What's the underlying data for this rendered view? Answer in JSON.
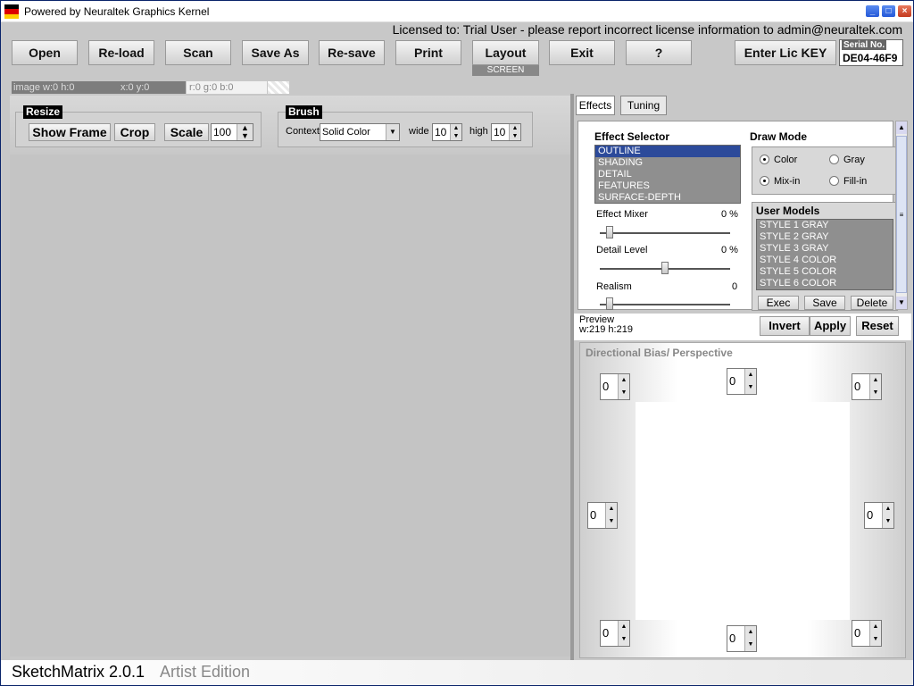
{
  "window": {
    "title": "Powered by Neuraltek Graphics Kernel",
    "minimize": "_",
    "maximize": "□",
    "close": "×",
    "flag_colors": [
      "#000000",
      "#dd0000",
      "#ffce00"
    ]
  },
  "license_text": "Licensed to: Trial User - please report incorrect license information to admin@neuraltek.com",
  "toolbar": {
    "open": "Open",
    "reload": "Re-load",
    "scan": "Scan",
    "save_as": "Save As",
    "resave": "Re-save",
    "print": "Print",
    "layout": "Layout",
    "layout_mode": "SCREEN",
    "exit": "Exit",
    "help": "?",
    "enter_key": "Enter Lic KEY",
    "serial_label": "Serial No.",
    "serial_value": "DE04-46F9"
  },
  "status": {
    "image_size": "image w:0 h:0",
    "xy": "x:0 y:0",
    "rgb": "r:0 g:0 b:0"
  },
  "resize": {
    "label": "Resize",
    "show_frame": "Show Frame",
    "crop": "Crop",
    "scale": "Scale",
    "scale_value": "100"
  },
  "brush": {
    "label": "Brush",
    "context_label": "Context",
    "context_value": "Solid Color",
    "wide_label": "wide",
    "wide_value": "10",
    "high_label": "high",
    "high_value": "10"
  },
  "tabs": {
    "effects": "Effects",
    "tuning": "Tuning"
  },
  "effect_selector": {
    "heading": "Effect Selector",
    "items": [
      "OUTLINE",
      "SHADING",
      "DETAIL",
      "FEATURES",
      "SURFACE-DEPTH"
    ],
    "selected_index": 0
  },
  "sliders": {
    "effect_mixer": {
      "label": "Effect Mixer",
      "value": "0 %",
      "level": 0.05
    },
    "detail_level": {
      "label": "Detail Level",
      "value": "0 %",
      "level": 0.5
    },
    "realism": {
      "label": "Realism",
      "value": "0",
      "level": 0.05
    }
  },
  "draw_mode": {
    "heading": "Draw Mode",
    "color": "Color",
    "gray": "Gray",
    "mixin": "Mix-in",
    "fillin": "Fill-in"
  },
  "user_models": {
    "heading": "User Models",
    "items": [
      "STYLE 1 GRAY",
      "STYLE 2 GRAY",
      "STYLE 3 GRAY",
      "STYLE 4 COLOR",
      "STYLE 5 COLOR",
      "STYLE 6 COLOR"
    ],
    "exec": "Exec",
    "save": "Save",
    "delete": "Delete"
  },
  "preview": {
    "label": "Preview",
    "size": "w:219 h:219",
    "invert": "Invert",
    "apply": "Apply",
    "reset": "Reset"
  },
  "bias": {
    "title": "Directional Bias/ Perspective",
    "top_left": "0",
    "top": "0",
    "top_right": "0",
    "left": "0",
    "right": "0",
    "bottom_left": "0",
    "bottom": "0",
    "bottom_right": "0"
  },
  "footer": {
    "app_name": "SketchMatrix 2.0.1",
    "edition": "Artist Edition"
  }
}
